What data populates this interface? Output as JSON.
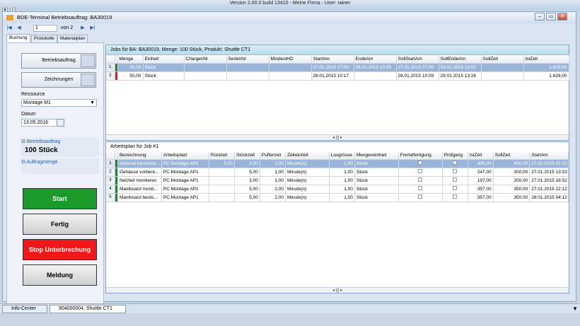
{
  "app": {
    "title": "Version 2.00.0  build 13410 - Meine Firma - User: rainer"
  },
  "window": {
    "title": "BDE-Terminal Betriebsauftrag: BA30019"
  },
  "nav": {
    "page_value": "1",
    "page_of": "von 2"
  },
  "tabs": [
    {
      "label": "Buchung"
    },
    {
      "label": "Protokolle"
    },
    {
      "label": "Materialplan"
    }
  ],
  "left": {
    "betriebsauftrag_btn": "Betriebsauftrag",
    "zeichnungen_btn": "Zeichnungen",
    "ressource_label": "Ressource",
    "ressource_value": "Montage M1",
    "datum_label": "Datum",
    "datum_value": "13.05.2016",
    "ba_section": "Betriebsauftrag",
    "qty": "100 Stück",
    "auftragmenge": "Auftragmenge",
    "start": "Start",
    "fertig": "Fertig",
    "stop": "Stop Unterbrechung",
    "meldung": "Meldung"
  },
  "jobs": {
    "header": "Jobs für BA: BA30019, Menge: 100 Stück, Produkt: Shuttle CT1",
    "columns": [
      "Menge",
      "Einheit",
      "ChargenNr",
      "SerienNr",
      "MindestHD",
      "StartAm",
      "EndeAm",
      "SollStartAm",
      "SollEndeAm",
      "SollZeit",
      "IstZeit"
    ],
    "rows": [
      {
        "idx": "1",
        "menge": "50,00",
        "einheit": "Stück",
        "charge": "",
        "serie": "",
        "mhd": "",
        "start": "27.01.2015 07:00",
        "ende": "28.01.2015 10:09",
        "sollstart": "27.01.2015 07:00",
        "sollende": "28.01.2015 10:02",
        "sollzeit": "",
        "istzeit": "1.629,00",
        "bar": "#1a8a2a"
      },
      {
        "idx": "2",
        "menge": "50,00",
        "einheit": "Stück",
        "charge": "",
        "serie": "",
        "mhd": "",
        "start": "28.01.2015 10:17",
        "ende": "",
        "sollstart": "28.01.2015 10:09",
        "sollende": "29.01.2015 13:26",
        "sollzeit": "",
        "istzeit": "1.629,00",
        "bar": "#e02020"
      }
    ]
  },
  "plan": {
    "header": "Arbeitsplan für Job #1",
    "columns": [
      "Bezeichnung",
      "Arbeitsplatz",
      "Rüstzeit",
      "Stückzeit",
      "Pufferzeit",
      "Zeiteinheit",
      "Losgrösse",
      "Mengeneinheit",
      "Fremdfertigung",
      "Prüfgang",
      "IstZeit",
      "SollZeit",
      "StartAm"
    ],
    "rows": [
      {
        "idx": "1",
        "bez": "Material bereitstel...",
        "ap": "PC Montage AP1",
        "ruest": "3,00",
        "stueck": "3,00",
        "puffer": "2,00",
        "ze": "Minute(n)",
        "los": "1,00",
        "me": "Stück",
        "ist": "405,00",
        "soll": "400,00",
        "start": "27.01.2015 07:01"
      },
      {
        "idx": "2",
        "bez": "Gehäuse vorbere...",
        "ap": "PC Montage AP1",
        "ruest": "",
        "stueck": "5,00",
        "puffer": "1,00",
        "ze": "Minute(n)",
        "los": "1,00",
        "me": "Stück",
        "ist": "247,00",
        "soll": "300,00",
        "start": "27.01.2015 13:53"
      },
      {
        "idx": "3",
        "bez": "Netzteil montieren",
        "ap": "PC Montage AP1",
        "ruest": "",
        "stueck": "3,00",
        "puffer": "1,00",
        "ze": "Minute(n)",
        "los": "1,00",
        "me": "Stück",
        "ist": "197,00",
        "soll": "200,00",
        "start": "27.01.2015 18:52"
      },
      {
        "idx": "4",
        "bez": "Mainboard monti...",
        "ap": "PC Montage AP1",
        "ruest": "",
        "stueck": "5,00",
        "puffer": "2,00",
        "ze": "Minute(n)",
        "los": "1,00",
        "me": "Stück",
        "ist": "357,00",
        "soll": "350,00",
        "start": "27.01.2015 22:12"
      },
      {
        "idx": "5",
        "bez": "Mainboard bestü...",
        "ap": "PC Montage AP1",
        "ruest": "",
        "stueck": "5,00",
        "puffer": "2,00",
        "ze": "Minute(n)",
        "los": "1,00",
        "me": "Stück",
        "ist": "357,00",
        "soll": "350,00",
        "start": "28.01.2015 04:12"
      }
    ]
  },
  "status": {
    "tab1": "Info-Center",
    "tab2": "904000004, Shuttle CT1"
  },
  "colors": {
    "start": "#1a9a2a",
    "stop": "#f01818",
    "jobhdr": "#c5e4f0"
  }
}
